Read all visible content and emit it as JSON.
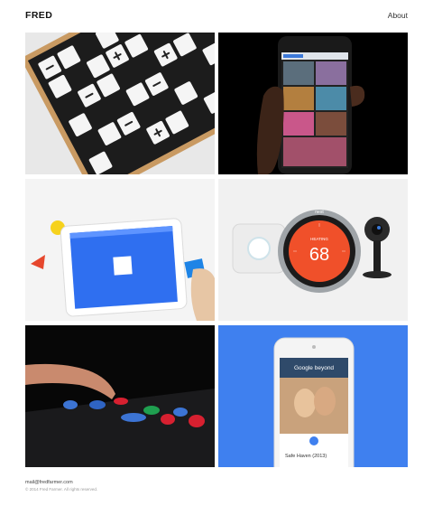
{
  "site": {
    "brand": "FRED"
  },
  "nav": {
    "about_label": "About"
  },
  "tiles": [
    {
      "name": "crossword-board"
    },
    {
      "name": "phone-photo-app"
    },
    {
      "name": "tablet-shapes-game"
    },
    {
      "name": "smart-home-devices",
      "thermostat_label": "HEATING",
      "thermostat_value": "68",
      "brand_mark": "nest"
    },
    {
      "name": "clay-tabletop"
    },
    {
      "name": "google-beyond-app",
      "app_title": "Google beyond",
      "movie_title": "Safe Haven (2013)"
    }
  ],
  "footer": {
    "email": "mail@fredfarmer.com",
    "copyright": "© 2014 Fred Farmer. All rights reserved."
  },
  "colors": {
    "accent_blue": "#3f80ef",
    "thermostat_orange": "#f0502a",
    "text_dark": "#111111"
  }
}
